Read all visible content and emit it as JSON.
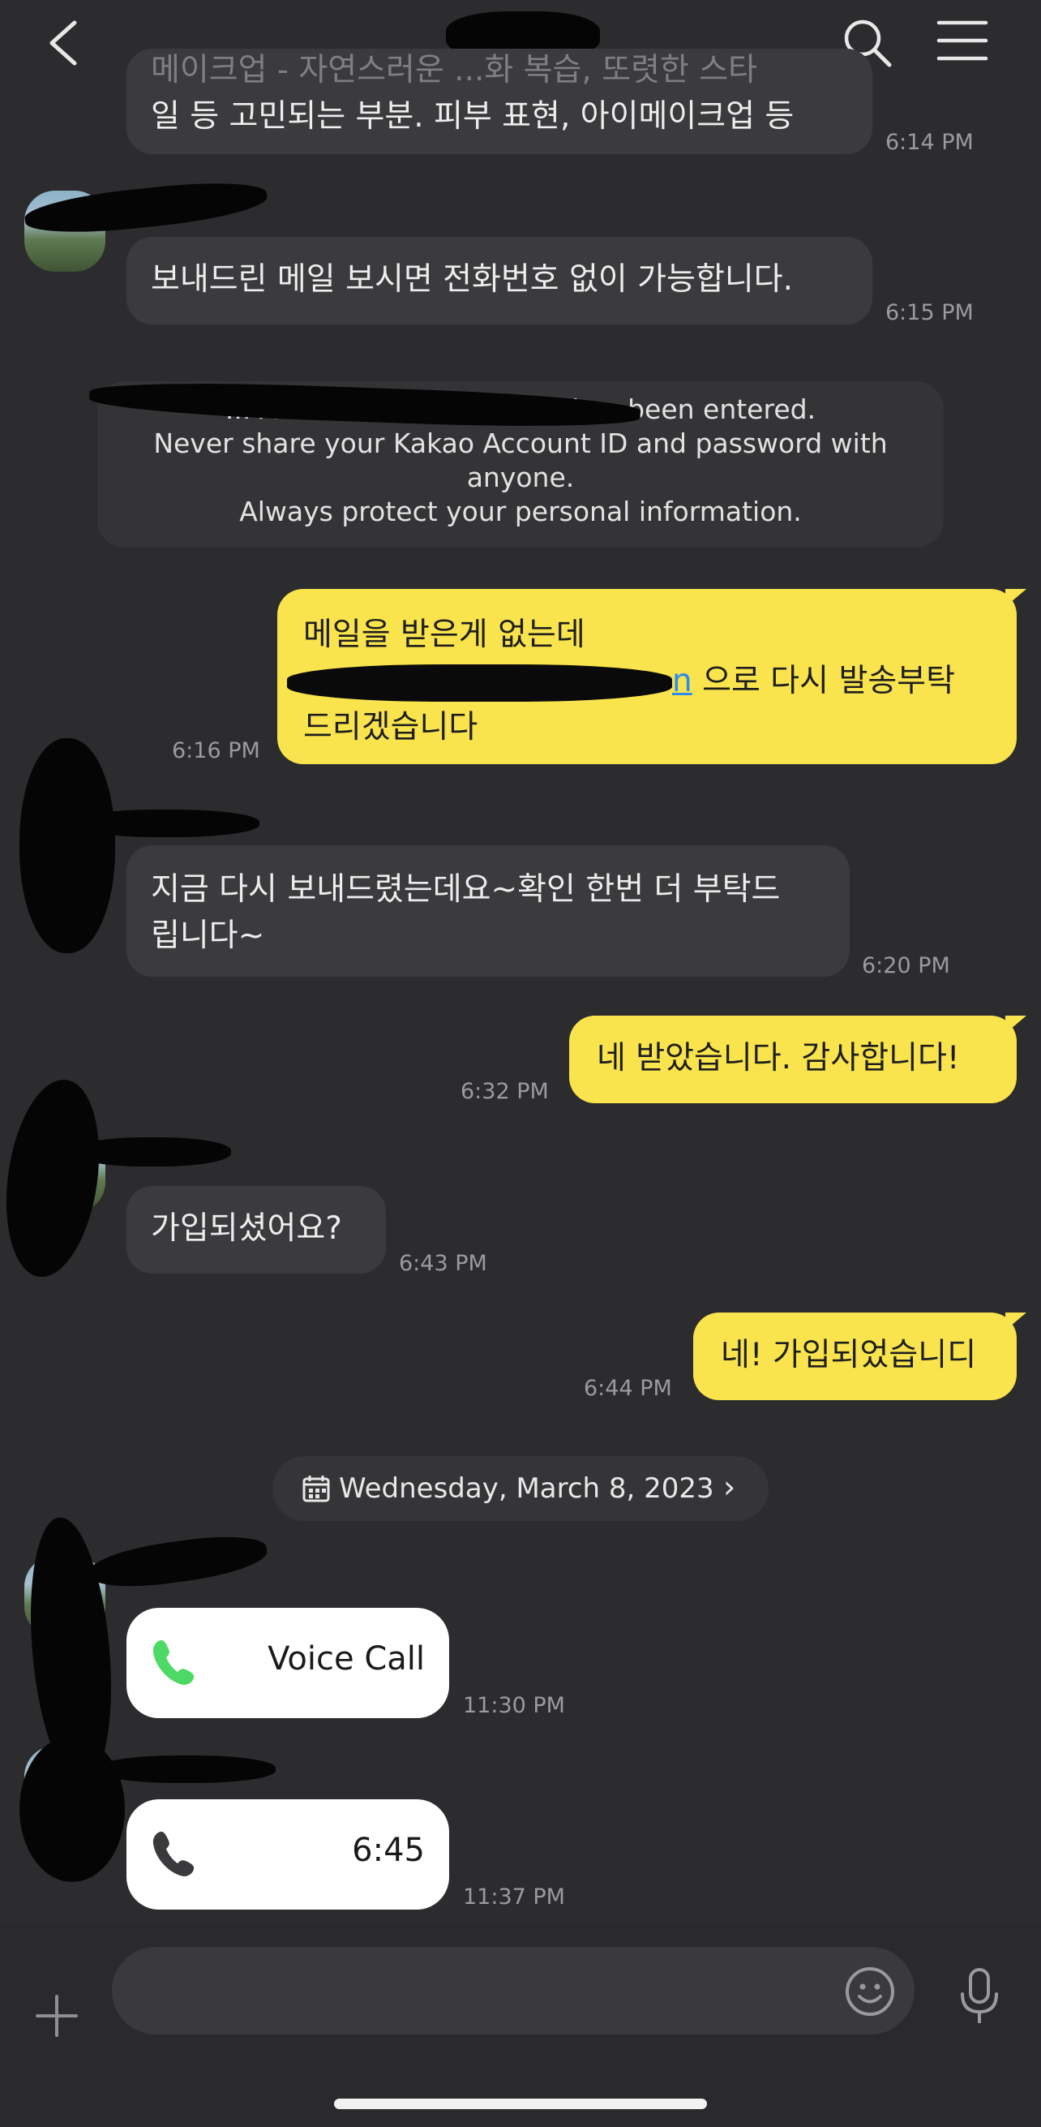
{
  "header": {
    "partial_top_text": "메이크업 - 자연스러운 ...화 복습, 또렷한 스타"
  },
  "messages": [
    {
      "text": "일 등 고민되는 부분. 피부 표현, 아이메이크업 등",
      "time": "6:14 PM"
    },
    {
      "text": "보내드린 메일 보시면 전화번호 없이 가능합니다.",
      "time": "6:15 PM"
    },
    {
      "notice_lines": [
        "... Account email address has been entered.",
        "Never share your Kakao Account ID and password with",
        "anyone.",
        "Always protect your personal information."
      ]
    },
    {
      "line1": "메일을 받은게 없는데",
      "link": "n",
      "line2_rest": "으로 다시 발송부탁",
      "line3": "드리겠습니다",
      "time": "6:16 PM"
    },
    {
      "line1": "지금 다시 보내드렸는데요~확인 한번 더 부탁드",
      "line2": "립니다~",
      "time": "6:20 PM"
    },
    {
      "text": "네 받았습니다. 감사합니다!",
      "time": "6:32 PM"
    },
    {
      "text": "가입되셨어요?",
      "time": "6:43 PM"
    },
    {
      "text": "네! 가입되었습니디",
      "time": "6:44 PM"
    },
    {
      "label": "Voice Call",
      "time": "11:30 PM"
    },
    {
      "label": "6:45",
      "time": "11:37 PM"
    }
  ],
  "date_chip": {
    "label": "Wednesday, March 8, 2023",
    "chevron": "›"
  },
  "composer": {
    "placeholder": ""
  },
  "icons": {
    "back": "chevron-left-icon",
    "search": "search-icon",
    "menu": "hamburger-menu-icon",
    "add": "plus-icon",
    "emoji": "smiley-icon",
    "mic": "microphone-icon",
    "call_green": "phone-icon",
    "call_gray": "phone-icon"
  },
  "colors": {
    "background": "#2c2c2f",
    "incoming_bubble": "#3b3b3e",
    "outgoing_bubble": "#fae44d",
    "link": "#2a8bf2",
    "call_green": "#4cd964"
  }
}
